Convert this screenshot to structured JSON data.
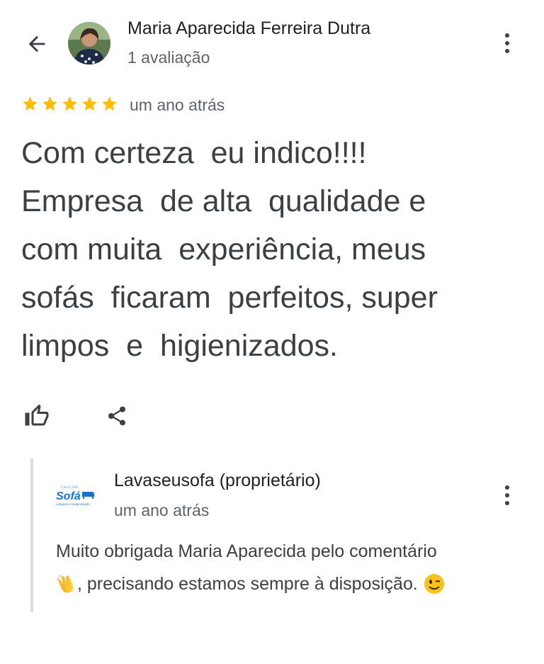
{
  "reviewer": {
    "name": "Maria Aparecida Ferreira Dutra",
    "review_count": "1 avaliação"
  },
  "review": {
    "rating": 5,
    "max_rating": 5,
    "time": "um ano atrás",
    "text": "Com certeza  eu indico!!!!\nEmpresa  de alta  qualidade e\ncom muita  experiência, meus\nsofás  ficaram  perfeitos, super\nlimpos  e  higienizados."
  },
  "reply": {
    "owner": "Lavaseusofa (proprietário)",
    "time": "um ano atrás",
    "text_line1": "Muito obrigada Maria Aparecida pelo comentário",
    "text_line2": ", precisando estamos sempre à disposição.",
    "logo_text": "Sofá"
  },
  "colors": {
    "star": "#fbbc04",
    "text": "#3c4043",
    "secondary": "#5f6368",
    "logo_blue": "#1a73c8"
  },
  "icons": {
    "back": "arrow-back-icon",
    "more": "more-vert-icon",
    "like": "thumb-up-icon",
    "share": "share-icon"
  }
}
